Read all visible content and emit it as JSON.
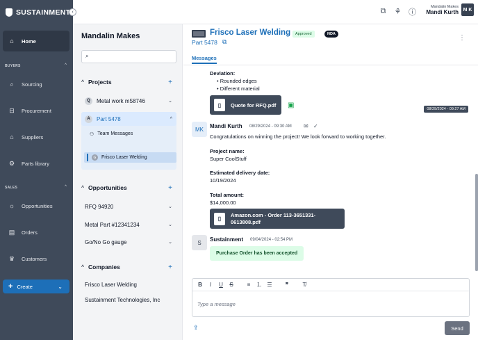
{
  "brand": {
    "name": "SUSTAINMENT"
  },
  "header": {
    "org": "Mandalin Makes",
    "user": "Mandi Kurth",
    "initials": "M K"
  },
  "sidebar": {
    "home": "Home",
    "buyers_label": "BUYERS",
    "sourcing": "Sourcing",
    "procurement": "Procurement",
    "suppliers": "Suppliers",
    "parts_library": "Parts library",
    "sales_label": "SALES",
    "opportunities": "Opportunities",
    "orders": "Orders",
    "customers": "Customers",
    "create": "Create"
  },
  "middle": {
    "title": "Mandalin Makes",
    "search_placeholder": "",
    "projects_label": "Projects",
    "projects": [
      {
        "badge": "Q",
        "label": "Metal work m58746"
      },
      {
        "badge": "A",
        "label": "Part 5478"
      }
    ],
    "team_messages": "Team Messages",
    "active_thread": "Frisco Laser Welding",
    "active_thread_badge": "G",
    "opportunities_label": "Opportunities",
    "opportunities": [
      "RFQ 94920",
      "Metal Part #12341234",
      "Go/No Go gauge"
    ],
    "companies_label": "Companies",
    "companies": [
      "Frisco Laser Welding",
      "Sustainment Technologies, Inc"
    ]
  },
  "main": {
    "title": "Frisco Laser Welding",
    "status": "Approved",
    "nda": "NDA",
    "part": "Part 5478",
    "tab": "Messages",
    "deviation_label": "Deviation:",
    "deviations": [
      "Rounded edges",
      "Different material"
    ],
    "quote_file": "Quote for RFQ.pdf",
    "quote_ts": "08/29/2024 - 09:27 AM",
    "msg1": {
      "initials": "MK",
      "sender": "Mandi Kurth",
      "time": "08/29/2024 - 09:30 AM",
      "body": "Congratulations on winning the project! We look forward to working together.",
      "project_name_label": "Project name:",
      "project_name": "Super CoolStuff",
      "delivery_label": "Estimated delivery date:",
      "delivery": "10/19/2024",
      "total_label": "Total amount:",
      "total": "$14,000.00",
      "file_line1": "Amazon.com - Order 113-3651331-",
      "file_line2": "0613808.pdf"
    },
    "msg2": {
      "initials": "S",
      "sender": "Sustainment",
      "time": "09/04/2024 - 02:54 PM",
      "pill": "Purchase Order has been accepted"
    },
    "editor_placeholder": "Type a message",
    "send": "Send"
  }
}
